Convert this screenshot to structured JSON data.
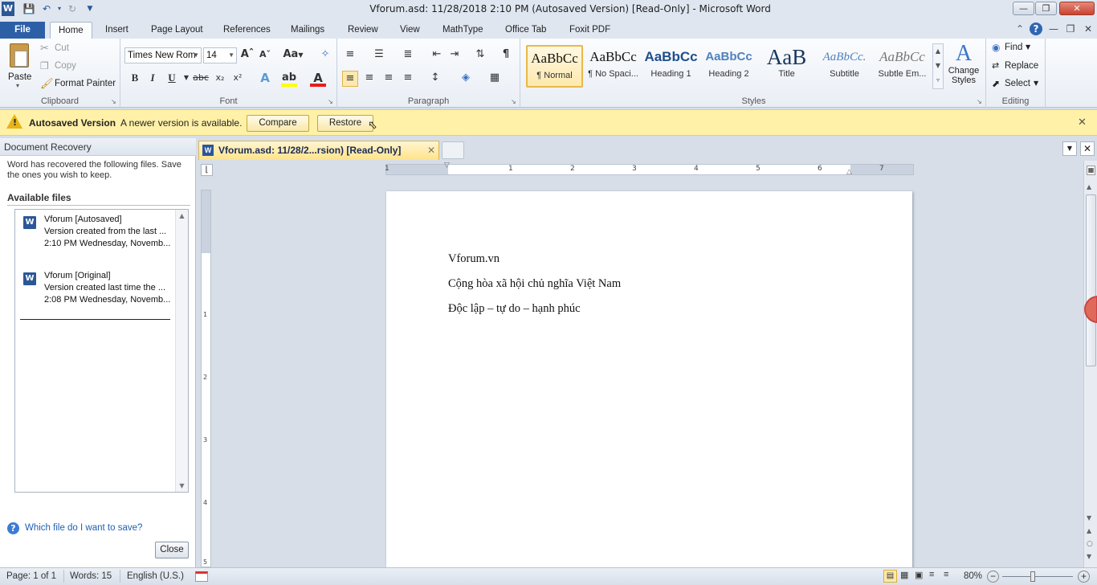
{
  "window": {
    "title": "Vforum.asd: 11/28/2018 2:10 PM (Autosaved Version) [Read-Only]  -  Microsoft Word"
  },
  "ribbon_tabs": [
    "File",
    "Home",
    "Insert",
    "Page Layout",
    "References",
    "Mailings",
    "Review",
    "View",
    "MathType",
    "Office Tab",
    "Foxit PDF"
  ],
  "clipboard": {
    "paste": "Paste",
    "cut": "Cut",
    "copy": "Copy",
    "format_painter": "Format Painter",
    "label": "Clipboard"
  },
  "font": {
    "name": "Times New Rom",
    "size": "14",
    "label": "Font",
    "change_case": "Aa"
  },
  "paragraph": {
    "label": "Paragraph"
  },
  "styles": {
    "label": "Styles",
    "items": [
      {
        "preview": "AaBbCc",
        "name": "¶ Normal"
      },
      {
        "preview": "AaBbCc",
        "name": "¶ No Spaci..."
      },
      {
        "preview": "AaBbCc",
        "name": "Heading 1"
      },
      {
        "preview": "AaBbCc",
        "name": "Heading 2"
      },
      {
        "preview": "AaB",
        "name": "Title"
      },
      {
        "preview": "AaBbCc.",
        "name": "Subtitle"
      },
      {
        "preview": "AaBbCc",
        "name": "Subtle Em..."
      }
    ],
    "change_styles": "Change Styles"
  },
  "editing": {
    "find": "Find",
    "replace": "Replace",
    "select": "Select",
    "label": "Editing"
  },
  "infobar": {
    "title": "Autosaved Version",
    "message": "A newer version is available.",
    "compare": "Compare",
    "restore": "Restore"
  },
  "recovery": {
    "header": "Document Recovery",
    "intro": "Word has recovered the following files.  Save the ones you wish to keep.",
    "available": "Available files",
    "files": [
      {
        "name": "Vforum  [Autosaved]",
        "desc": "Version created from the last ...",
        "time": "2:10 PM Wednesday, Novemb..."
      },
      {
        "name": "Vforum  [Original]",
        "desc": "Version created last time the ...",
        "time": "2:08 PM Wednesday, Novemb..."
      }
    ],
    "help": "Which file do I want to save?",
    "close": "Close"
  },
  "doc_tab": {
    "label": "Vforum.asd: 11/28/2...rsion) [Read-Only]"
  },
  "ruler": {
    "numbers": [
      "1",
      "1",
      "2",
      "3",
      "4",
      "5",
      "6",
      "7"
    ],
    "vnumbers": [
      "1",
      "2",
      "3",
      "4",
      "5"
    ]
  },
  "document": {
    "lines": [
      "Vforum.vn",
      "Cộng hòa xã hội chủ nghĩa Việt Nam",
      "Độc lập – tự do – hạnh phúc"
    ]
  },
  "status": {
    "page": "Page: 1 of 1",
    "words": "Words: 15",
    "language": "English (U.S.)",
    "zoom": "80%"
  }
}
